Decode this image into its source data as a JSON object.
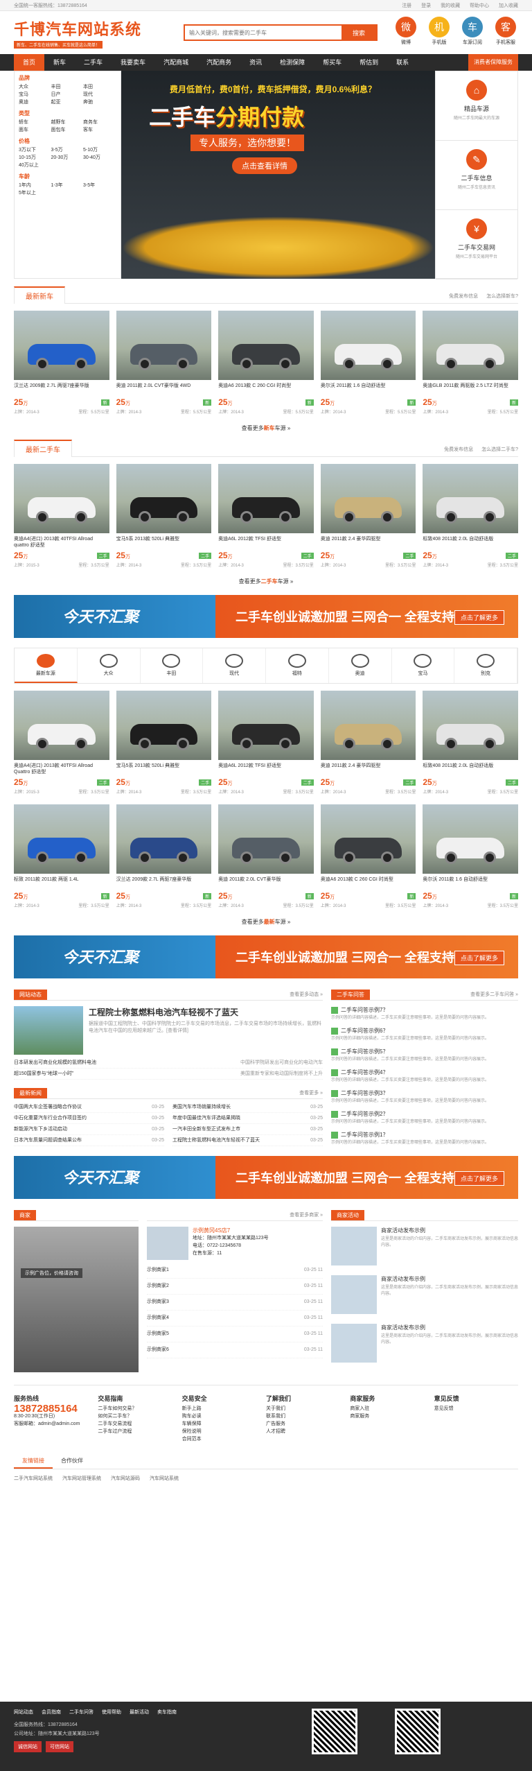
{
  "topbar": {
    "left": "全国统一客服热线：13872885164",
    "links": [
      "注册",
      "登录",
      "我的收藏",
      "帮助中心",
      "加入收藏"
    ]
  },
  "logo": {
    "title": "千博汽车网站系统",
    "slogan": "新车、二手车在线销售、买车就是这么简单！"
  },
  "search": {
    "placeholder": "输入关键词，搜索需要的二手车",
    "button": "搜索"
  },
  "header_icons": [
    {
      "label": "微博",
      "color": "#e8561d",
      "glyph": "微"
    },
    {
      "label": "手机版",
      "color": "#f6b21a",
      "glyph": "机"
    },
    {
      "label": "车源订阅",
      "color": "#3c8dbc",
      "glyph": "车"
    },
    {
      "label": "手机客服",
      "color": "#e8561d",
      "glyph": "客"
    }
  ],
  "nav": {
    "items": [
      "首页",
      "新车",
      "二手车",
      "我要卖车",
      "汽配商城",
      "汽配商务",
      "资讯",
      "检测保障",
      "帮买车",
      "帮估到",
      "联系"
    ],
    "right": "消费者保障服务"
  },
  "sidebar": {
    "groups": [
      {
        "title": "品牌",
        "items": [
          "大众",
          "丰田",
          "本田",
          "宝马",
          "日产",
          "现代",
          "奥迪",
          "起亚",
          "奔驰"
        ]
      },
      {
        "title": "类型",
        "items": [
          "轿车",
          "越野车",
          "商务车",
          "面车",
          "面包车",
          "客车"
        ]
      },
      {
        "title": "价格",
        "items": [
          "3万以下",
          "3-5万",
          "5-10万",
          "10-15万",
          "20-30万",
          "30-40万",
          "40万以上"
        ]
      },
      {
        "title": "车龄",
        "items": [
          "1年内",
          "1-3年",
          "3-5年",
          "5年以上"
        ]
      }
    ]
  },
  "hero": {
    "l1": "费月低首付，费0首付，费车抵押借贷，费月0.6%利息？",
    "l2a": "二手车",
    "l2b": "分期付款",
    "l3": "专人服务，选你想要！",
    "cta": "点击查看详情"
  },
  "right_boxes": [
    {
      "title": "精品车源",
      "sub": "随州二手车网最大的车源",
      "glyph": "⌂"
    },
    {
      "title": "二手车信息",
      "sub": "随州二手车信息资讯",
      "glyph": "✎"
    },
    {
      "title": "二手车交易网",
      "sub": "随州二手车交易网平台",
      "glyph": "¥"
    }
  ],
  "sec1": {
    "tab": "最新新车",
    "links": [
      "免费发布信息",
      "怎么选择新车?"
    ],
    "more_a": "查看更多",
    "more_b": "新车",
    "more_c": "车源"
  },
  "sec2": {
    "tab": "最新二手车",
    "links": [
      "免费发布信息",
      "怎么选择二手车?"
    ],
    "more_a": "查看更多",
    "more_b": "二手车",
    "more_c": "车源"
  },
  "cars_new": [
    {
      "name": "汉兰达 2009款 2.7L 两驱7座豪华版",
      "price": "25",
      "unit": "万",
      "tag": "新",
      "date": "上牌：2014-3",
      "km": "里程：5.5万公里",
      "color": "#2360c9"
    },
    {
      "name": "奥迪 2011款 2.0L CVT豪华版 4WD",
      "price": "25",
      "unit": "万",
      "tag": "新",
      "date": "上牌：2014-3",
      "km": "里程：5.5万公里",
      "color": "#555e66"
    },
    {
      "name": "奥迪A6 2013款 C 260 CGI 时尚型",
      "price": "25",
      "unit": "万",
      "tag": "新",
      "date": "上牌：2014-3",
      "km": "里程：5.5万公里",
      "color": "#3a3d40"
    },
    {
      "name": "奥尔沃 2011款 1.6 自动舒适型",
      "price": "25",
      "unit": "万",
      "tag": "新",
      "date": "上牌：2014-3",
      "km": "里程：5.5万公里",
      "color": "#f0f0f0"
    },
    {
      "name": "奥迪GLB 2011款 两驱版 2.5 LTZ 时尚型",
      "price": "25",
      "unit": "万",
      "tag": "新",
      "date": "上牌：2014-3",
      "km": "里程：5.5万公里",
      "color": "#e8e8e8"
    }
  ],
  "cars_used": [
    {
      "name": "奥迪A4(进口) 2013款 40TFSI Allroad quattro 舒适型",
      "price": "25",
      "unit": "万",
      "tag": "二手",
      "date": "上牌：2015-3",
      "km": "里程：3.5万公里",
      "color": "#f2f2f2"
    },
    {
      "name": "宝马5系 2013款 520Li 典雅型",
      "price": "25",
      "unit": "万",
      "tag": "二手",
      "date": "上牌：2014-3",
      "km": "里程：3.5万公里",
      "color": "#1e1e1e"
    },
    {
      "name": "奥迪A6L 2012款 TFSI 舒适型",
      "price": "25",
      "unit": "万",
      "tag": "二手",
      "date": "上牌：2014-3",
      "km": "里程：3.5万公里",
      "color": "#222"
    },
    {
      "name": "奥迪 2011款 2.4 豪华四驱型",
      "price": "25",
      "unit": "万",
      "tag": "二手",
      "date": "上牌：2014-3",
      "km": "里程：3.5万公里",
      "color": "#c9b27c"
    },
    {
      "name": "标致408 2011款 2.0L 自动舒适版",
      "price": "25",
      "unit": "万",
      "tag": "二手",
      "date": "上牌：2014-3",
      "km": "里程：3.5万公里",
      "color": "#e4e4e4"
    }
  ],
  "ad": {
    "a1": "今天不汇聚",
    "a2": "二手车创业诚邀加盟  三网合一 全程支持",
    "a3": "点击了解更多"
  },
  "brands": [
    {
      "name": "最新车源"
    },
    {
      "name": "大众"
    },
    {
      "name": "丰田"
    },
    {
      "name": "现代"
    },
    {
      "name": "福特"
    },
    {
      "name": "奥迪"
    },
    {
      "name": "宝马"
    },
    {
      "name": "别克"
    }
  ],
  "brand_cars_r1": [
    {
      "name": "奥迪A4(进口) 2013款 40TFSI Allroad Quattro 舒适型",
      "price": "25",
      "unit": "万",
      "tag": "二手",
      "date": "上牌：2015-3",
      "km": "里程：3.5万公里",
      "color": "#f2f2f2"
    },
    {
      "name": "宝马5系 2013款 520Li 典雅型",
      "price": "25",
      "unit": "万",
      "tag": "二手",
      "date": "上牌：2014-3",
      "km": "里程：3.5万公里",
      "color": "#1e1e1e"
    },
    {
      "name": "奥迪A6L 2012款 TFSI 舒适型",
      "price": "25",
      "unit": "万",
      "tag": "二手",
      "date": "上牌：2014-3",
      "km": "里程：3.5万公里",
      "color": "#2a2a2a"
    },
    {
      "name": "奥迪 2011款 2.4 豪华四驱型",
      "price": "25",
      "unit": "万",
      "tag": "二手",
      "date": "上牌：2014-3",
      "km": "里程：3.5万公里",
      "color": "#c9b27c"
    },
    {
      "name": "标致408 2011款 2.0L 自动舒适版",
      "price": "25",
      "unit": "万",
      "tag": "二手",
      "date": "上牌：2014-3",
      "km": "里程：3.5万公里",
      "color": "#e4e4e4"
    }
  ],
  "brand_cars_r2": [
    {
      "name": "标致 2011款 2011款 两驱 1.4L",
      "price": "25",
      "unit": "万",
      "tag": "新",
      "date": "上牌：2014-3",
      "km": "里程：3.5万公里",
      "color": "#2360c9"
    },
    {
      "name": "汉兰达 2009款 2.7L 两驱7座豪华版",
      "price": "25",
      "unit": "万",
      "tag": "新",
      "date": "上牌：2014-3",
      "km": "里程：3.5万公里",
      "color": "#2a4a8a"
    },
    {
      "name": "奥迪 2011款 2.0L CVT豪华版",
      "price": "25",
      "unit": "万",
      "tag": "新",
      "date": "上牌：2014-3",
      "km": "里程：3.5万公里",
      "color": "#555e66"
    },
    {
      "name": "奥迪A6 2013款 C 260 CGI 时尚型",
      "price": "25",
      "unit": "万",
      "tag": "新",
      "date": "上牌：2014-3",
      "km": "里程：3.5万公里",
      "color": "#3a3d40"
    },
    {
      "name": "奥尔沃 2011款 1.6 自动舒适型",
      "price": "25",
      "unit": "万",
      "tag": "新",
      "date": "上牌：2014-3",
      "km": "里程：3.5万公里",
      "color": "#f0f0f0"
    }
  ],
  "sec3": {
    "more_a": "查看更多",
    "more_b": "最新",
    "more_c": "车源"
  },
  "news": {
    "tab": "网站动态",
    "more": "查看更多动态 »",
    "head_title": "工程院士称氢燃料电池汽车轻视不了蓝天",
    "head_desc": "据报道中国工程院院士、中国科学院院士的二手车交易的市场消息，二手车交易市场的市场持续增长，氢燃料电池汽车在中国的应用越来越广泛。[查看详情]",
    "items": [
      {
        "t": "日本研发出可商业化规模的氢燃料电池",
        "d": "中国科学院研发出可商业化的电动汽车"
      },
      {
        "t": "超150国家参与“地球一小时”",
        "d": "美国重新专家和电动国际制度将不上升"
      }
    ]
  },
  "hot": {
    "tab": "最新新闻",
    "more": "查看更多 »",
    "items": [
      {
        "t": "中国两大车企签署战略合作协议",
        "d": "03-25"
      },
      {
        "t": "美国汽车市场销量持续增长",
        "d": "03-25"
      },
      {
        "t": "中石化重要汽车行业合作项目签约",
        "d": "03-25"
      },
      {
        "t": "年度中国最佳汽车评选结果揭晓",
        "d": "03-25"
      },
      {
        "t": "新能源汽车下乡活动启动",
        "d": "03-25"
      },
      {
        "t": "一汽丰田全新车型正式发布上市",
        "d": "03-25"
      },
      {
        "t": "日本汽车质量问题调查结果公布",
        "d": "03-25"
      },
      {
        "t": "工程院士称氢燃料电池汽车轻视不了蓝天",
        "d": "03-25"
      }
    ]
  },
  "qa": {
    "tab": "二手车问答",
    "more": "查看更多二手车问答 »",
    "items": [
      {
        "t": "二手车问答示例7？",
        "d": "示例问答的详细内容描述，二手车买卖要注意哪些事项，这里是简要的问答内容展示。"
      },
      {
        "t": "二手车问答示例6？",
        "d": "示例问答的详细内容描述，二手车买卖要注意哪些事项，这里是简要的问答内容展示。"
      },
      {
        "t": "二手车问答示例5？",
        "d": "示例问答的详细内容描述，二手车买卖要注意哪些事项，这里是简要的问答内容展示。"
      },
      {
        "t": "二手车问答示例4？",
        "d": "示例问答的详细内容描述，二手车买卖要注意哪些事项，这里是简要的问答内容展示。"
      },
      {
        "t": "二手车问答示例3？",
        "d": "示例问答的详细内容描述，二手车买卖要注意哪些事项，这里是简要的问答内容展示。"
      },
      {
        "t": "二手车问答示例2？",
        "d": "示例问答的详细内容描述，二手车买卖要注意哪些事项，这里是简要的问答内容展示。"
      },
      {
        "t": "二手车问答示例1？",
        "d": "示例问答的详细内容描述，二手车买卖要注意哪些事项，这里是简要的问答内容展示。"
      }
    ]
  },
  "merchant": {
    "tab": "商家",
    "more": "查看更多商家 »",
    "left_caption": "示例广告位，价格请咨询",
    "shop_name": "示例黄冈4S店7",
    "shop_addr": "地址：随州市某某大道某某路123号",
    "shop_tel": "电话：0722-12345678",
    "shop_count": "在售车源：11",
    "list": [
      "示例商家1",
      "示例商家2",
      "示例商家3",
      "示例商家4",
      "示例商家5",
      "示例商家6"
    ],
    "list_date": "03-25 11",
    "r_tab": "商家活动",
    "acts": [
      {
        "t": "商家活动发布示例",
        "d": "这里是商家活动的介绍内容，二手车商家活动发布示例，展示商家活动信息内容。"
      },
      {
        "t": "商家活动发布示例",
        "d": "这里是商家活动的介绍内容，二手车商家活动发布示例，展示商家活动信息内容。"
      },
      {
        "t": "商家活动发布示例",
        "d": "这里是商家活动的介绍内容，二手车商家活动发布示例，展示商家活动信息内容。"
      }
    ]
  },
  "footer_info": [
    {
      "title": "服务热线",
      "tel": "13872885164",
      "lines": [
        "8:30-20:30(工作日)",
        "客服邮箱：admin@admin.com"
      ]
    },
    {
      "title": "交易指南",
      "lines": [
        "二手车如何交易？",
        "如何买二手车？",
        "二手车交易流程",
        "二手车过户流程"
      ]
    },
    {
      "title": "交易安全",
      "lines": [
        "新手上路",
        "购车必读",
        "车辆保障",
        "保险说明",
        "合同范本"
      ]
    },
    {
      "title": "了解我们",
      "lines": [
        "关于我们",
        "联系我们",
        "广告服务",
        "人才招聘"
      ]
    },
    {
      "title": "商家服务",
      "lines": [
        "商家入驻",
        "商家服务"
      ]
    },
    {
      "title": "意见反馈",
      "lines": [
        "意见反馈"
      ]
    }
  ],
  "friend": {
    "tabs": [
      "友情链接",
      "合作伙伴"
    ],
    "links": [
      "二手汽车网站系统",
      "汽车网站管理系统",
      "汽车网站源码",
      "汽车网站系统"
    ]
  },
  "bottom": {
    "links": [
      "网站动态",
      "会员指南",
      "二手车问答",
      "使用帮助",
      "最新活动",
      "卖车指南"
    ],
    "line1": "全国服务热线：13872885164",
    "line2": "公司地址：随州市某某大道某某路123号",
    "badge1": "诚信网站",
    "badge2": "可信网站"
  }
}
